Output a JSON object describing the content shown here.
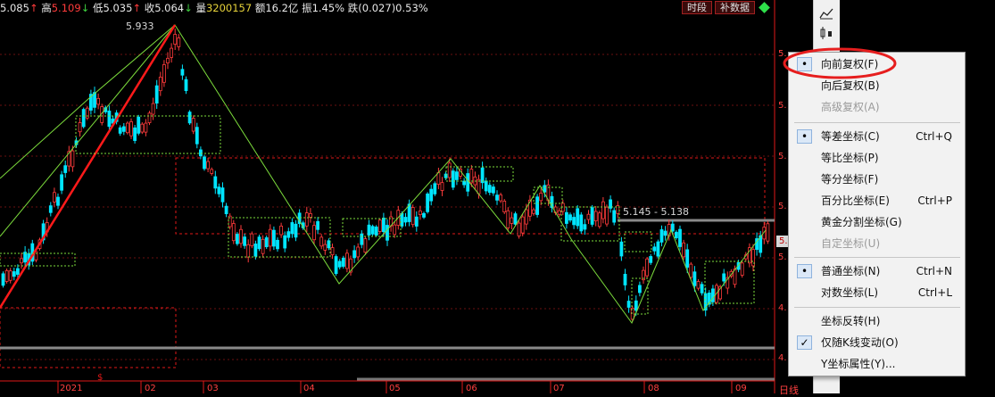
{
  "infobar": {
    "open_val": "5.085",
    "open_arrow": "↑",
    "high_label": "高",
    "high_val": "5.109",
    "high_arrow": "↓",
    "low_label": "低",
    "low_val": "5.035",
    "low_arrow": "↑",
    "close_label": "收",
    "close_val": "5.064",
    "close_arrow": "↓",
    "vol_label": "量",
    "vol_val": "3200157",
    "amt_label": "额",
    "amt_val": "16.2亿",
    "amp_label": "振",
    "amp_val": "1.45%",
    "chg_label": "跌",
    "chg_val": "(0.027)0.53%"
  },
  "buttons": {
    "timeseg": "时段",
    "supplement": "补数据"
  },
  "annotations": {
    "peak": "5.933",
    "range": "5.145 - 5.138"
  },
  "yaxis": {
    "labels": [
      "5.",
      "5.",
      "5.",
      "5.",
      "5.",
      "5.",
      "4.",
      "4."
    ],
    "price_tag": "5."
  },
  "xaxis": {
    "labels": [
      "2021",
      "02",
      "03",
      "04",
      "05",
      "06",
      "07",
      "08",
      "09"
    ],
    "period": "日线"
  },
  "context_menu": {
    "items": [
      {
        "label": "向前复权(F)",
        "shortcut": "",
        "checked": "•",
        "disabled": false
      },
      {
        "label": "向后复权(B)",
        "shortcut": "",
        "checked": "",
        "disabled": false
      },
      {
        "label": "高级复权(A)",
        "shortcut": "",
        "checked": "",
        "disabled": true
      },
      {
        "label": "等差坐标(C)",
        "shortcut": "Ctrl+Q",
        "checked": "•",
        "disabled": false
      },
      {
        "label": "等比坐标(P)",
        "shortcut": "",
        "checked": "",
        "disabled": false
      },
      {
        "label": "等分坐标(F)",
        "shortcut": "",
        "checked": "",
        "disabled": false
      },
      {
        "label": "百分比坐标(E)",
        "shortcut": "Ctrl+P",
        "checked": "",
        "disabled": false
      },
      {
        "label": "黄金分割坐标(G)",
        "shortcut": "",
        "checked": "",
        "disabled": false
      },
      {
        "label": "自定坐标(U)",
        "shortcut": "",
        "checked": "",
        "disabled": true
      },
      {
        "label": "普通坐标(N)",
        "shortcut": "Ctrl+N",
        "checked": "•",
        "disabled": false
      },
      {
        "label": "对数坐标(L)",
        "shortcut": "Ctrl+L",
        "checked": "",
        "disabled": false
      },
      {
        "label": "坐标反转(H)",
        "shortcut": "",
        "checked": "",
        "disabled": false
      },
      {
        "label": "仅随K线变动(O)",
        "shortcut": "",
        "checked": "✓",
        "disabled": false
      },
      {
        "label": "Y坐标属性(Y)...",
        "shortcut": "",
        "checked": "",
        "disabled": false
      }
    ]
  },
  "colors": {
    "up": "#ff3b3b",
    "down": "#00e5ff",
    "trend": "#7cdc3c",
    "accent_red": "#e01818"
  }
}
